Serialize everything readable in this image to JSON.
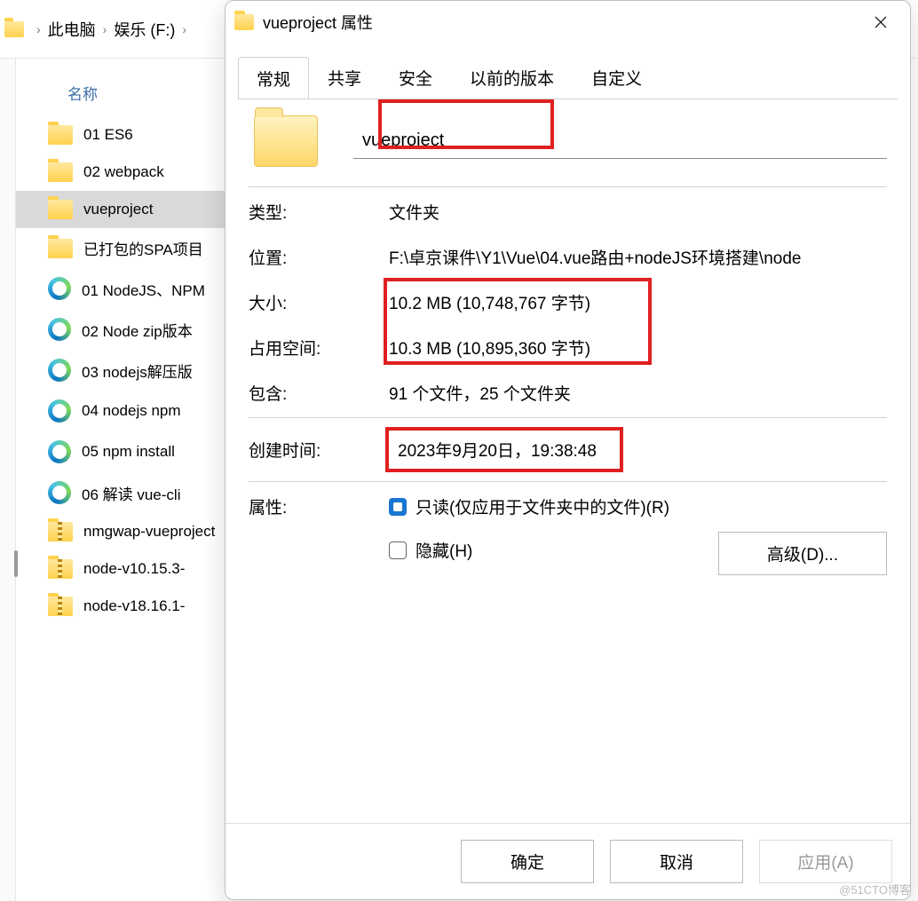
{
  "breadcrumb": {
    "item1": "此电脑",
    "item2": "娱乐 (F:)"
  },
  "explorer": {
    "column_name": "名称",
    "items": [
      {
        "type": "folder",
        "label": "01 ES6"
      },
      {
        "type": "folder",
        "label": "02 webpack"
      },
      {
        "type": "folder",
        "label": "vueproject",
        "selected": true
      },
      {
        "type": "folder",
        "label": "已打包的SPA项目"
      },
      {
        "type": "edge",
        "label": "01 NodeJS、NPM"
      },
      {
        "type": "edge",
        "label": "02 Node zip版本"
      },
      {
        "type": "edge",
        "label": "03 nodejs解压版"
      },
      {
        "type": "edge",
        "label": "04 nodejs npm"
      },
      {
        "type": "edge",
        "label": "05 npm install"
      },
      {
        "type": "edge",
        "label": "06 解读 vue-cli"
      },
      {
        "type": "zip",
        "label": "nmgwap-vueproject"
      },
      {
        "type": "zip",
        "label": "node-v10.15.3-"
      },
      {
        "type": "zip",
        "label": "node-v18.16.1-"
      }
    ]
  },
  "dialog": {
    "title": "vueproject 属性",
    "tabs": {
      "general": "常规",
      "sharing": "共享",
      "security": "安全",
      "previous": "以前的版本",
      "customize": "自定义"
    },
    "name_value": "vueproject",
    "labels": {
      "type": "类型:",
      "location": "位置:",
      "size": "大小:",
      "size_on_disk": "占用空间:",
      "contains": "包含:",
      "created": "创建时间:",
      "attributes": "属性:"
    },
    "values": {
      "type": "文件夹",
      "location": "F:\\卓京课件\\Y1\\Vue\\04.vue路由+nodeJS环境搭建\\node",
      "size": "10.2 MB (10,748,767 字节)",
      "size_on_disk": "10.3 MB (10,895,360 字节)",
      "contains": "91 个文件，25 个文件夹",
      "created": "2023年9月20日，19:38:48"
    },
    "readonly_label": "只读(仅应用于文件夹中的文件)(R)",
    "hidden_label": "隐藏(H)",
    "advanced_btn": "高级(D)...",
    "ok_btn": "确定",
    "cancel_btn": "取消",
    "apply_btn": "应用(A)"
  },
  "watermark": "@51CTO博客"
}
